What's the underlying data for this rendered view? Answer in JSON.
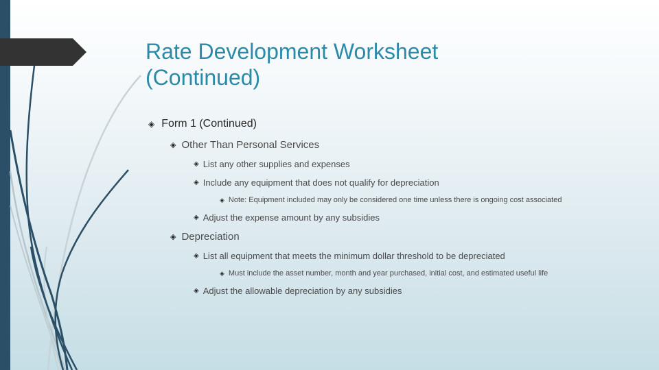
{
  "slide": {
    "title_line1": "Rate Development Worksheet",
    "title_line2": "(Continued)",
    "accent_color": "#2a8aa8",
    "sidebar_color": "#2b4f66",
    "bullet_icon": "diamond-bullet-icon",
    "bullets": {
      "form1": "Form 1 (Continued)",
      "otps": "Other Than Personal Services",
      "otps_items": [
        "List any other supplies and expenses",
        "Include any equipment that does not qualify for depreciation",
        "Adjust the expense amount by any subsidies"
      ],
      "otps_note": "Note: Equipment included may only be considered one time unless there is ongoing cost associated",
      "depreciation": "Depreciation",
      "dep_items": [
        "List all equipment that meets the minimum dollar threshold to be depreciated",
        "Adjust the allowable depreciation by any subsidies"
      ],
      "dep_note": "Must include the asset number, month and year purchased, initial cost, and estimated useful life"
    }
  }
}
